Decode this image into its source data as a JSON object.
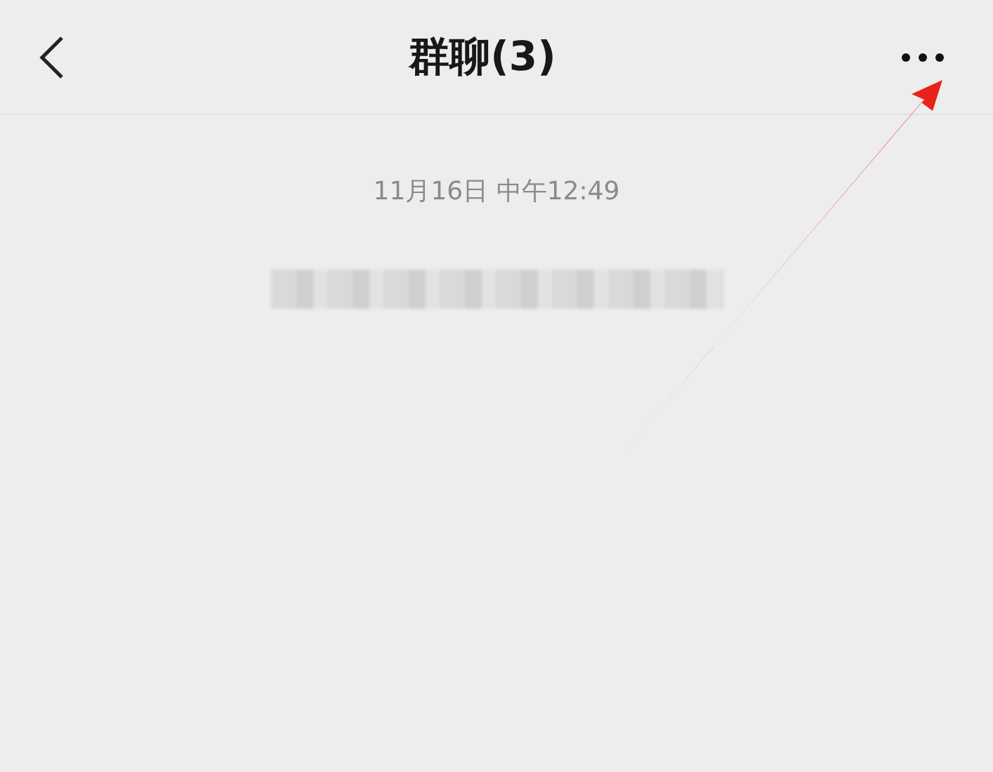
{
  "header": {
    "title": "群聊(3)"
  },
  "messages": [
    {
      "kind": "time",
      "text": "11月16日 中午12:49"
    },
    {
      "kind": "redacted"
    }
  ]
}
